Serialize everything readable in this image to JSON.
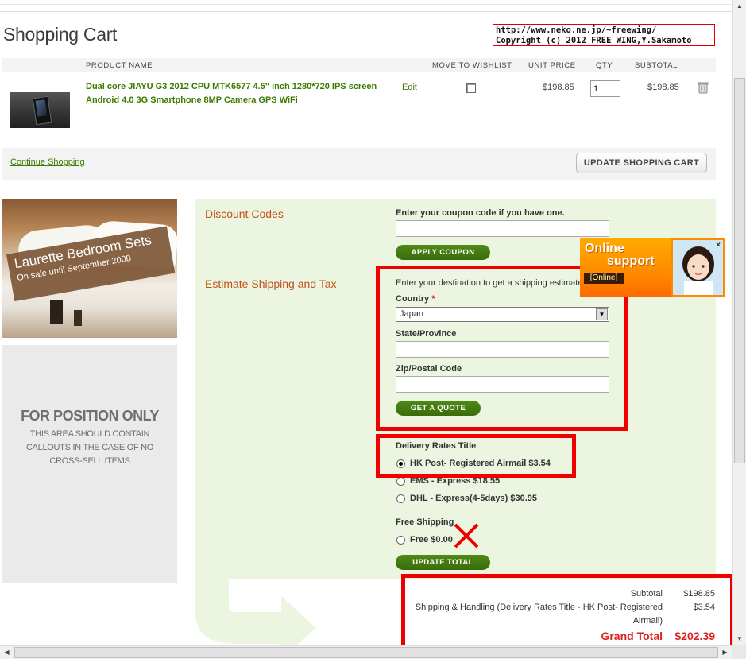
{
  "page": {
    "title": "Shopping Cart"
  },
  "credit": {
    "line1": "http://www.neko.ne.jp/~freewing/",
    "line2": "Copyright (c) 2012 FREE WING,Y.Sakamoto"
  },
  "cart": {
    "headers": {
      "product_name": "PRODUCT NAME",
      "wishlist": "MOVE TO WISHLIST",
      "unit_price": "UNIT PRICE",
      "qty": "QTY",
      "subtotal": "SUBTOTAL"
    },
    "item": {
      "name": "Dual core JIAYU G3 2012 CPU MTK6577 4.5\" inch 1280*720 IPS screen Android 4.0 3G Smartphone 8MP Camera GPS WiFi",
      "edit_label": "Edit",
      "unit_price": "$198.85",
      "qty": "1",
      "subtotal": "$198.85"
    },
    "continue_label": "Continue Shopping",
    "update_label": "UPDATE SHOPPING CART"
  },
  "promo": {
    "title": "Laurette Bedroom Sets",
    "subtitle": "On sale until September 2008"
  },
  "fpo": {
    "title": "FOR POSITION ONLY",
    "subtitle": "THIS AREA SHOULD CONTAIN CALLOUTS IN THE CASE OF NO CROSS-SELL ITEMS"
  },
  "discount": {
    "title": "Discount Codes",
    "prompt": "Enter your coupon code if you have one.",
    "code_value": "",
    "apply_label": "APPLY COUPON"
  },
  "shipping": {
    "title": "Estimate Shipping and Tax",
    "prompt": "Enter your destination to get a shipping estimate.",
    "country_label": "Country",
    "country_required": "*",
    "country_value": "Japan",
    "state_label": "State/Province",
    "state_value": "",
    "zip_label": "Zip/Postal Code",
    "zip_value": "",
    "quote_label": "GET A QUOTE",
    "rates_title": "Delivery Rates Title",
    "rates": [
      {
        "label": "HK Post- Registered Airmail $3.54",
        "checked": true
      },
      {
        "label": "EMS - Express $18.55",
        "checked": false
      },
      {
        "label": "DHL - Express(4-5days) $30.95",
        "checked": false
      }
    ],
    "free_title": "Free Shipping",
    "free_label": "Free $0.00",
    "update_total_label": "UPDATE TOTAL"
  },
  "totals": {
    "subtotal_label": "Subtotal",
    "subtotal_value": "$198.85",
    "shipping_label_1": "Shipping & Handling (Delivery Rates Title - HK Post- Registered",
    "shipping_label_2": "Airmail)",
    "shipping_value": "$3.54",
    "grand_label": "Grand Total",
    "grand_value": "$202.39"
  },
  "online_support": {
    "title_1": "Online",
    "title_2": "support",
    "badge": "[Online]",
    "close": "×"
  },
  "colors": {
    "accent_green": "#3d7a00",
    "button_green": "#4f8a17",
    "section_orange": "#c2521d",
    "annotation_red": "#e00000",
    "grand_total_red": "#d22222"
  }
}
